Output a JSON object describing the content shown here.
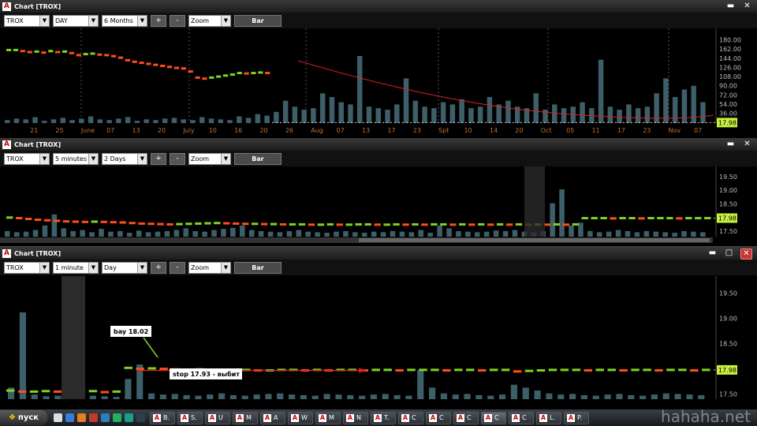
{
  "windows": [
    {
      "title": "Chart [TROX]",
      "symbol": "TROX",
      "interval": "DAY",
      "period": "6 Months",
      "zoom": "Zoom",
      "chart_type_button": "Bar",
      "plus": "+",
      "minus": "-",
      "price_ticks": [
        "180.00",
        "162.00",
        "144.00",
        "126.00",
        "108.00",
        "90.00",
        "72.00",
        "54.00",
        "36.00"
      ],
      "current_price": "17.98",
      "date_ticks": [
        "21",
        "25",
        "June",
        "07",
        "13",
        "20",
        "July",
        "10",
        "16",
        "20",
        "26",
        "Aug",
        "07",
        "13",
        "17",
        "23",
        "Spt",
        "10",
        "14",
        "20",
        "Oct",
        "05",
        "11",
        "17",
        "23",
        "Nov",
        "07"
      ]
    },
    {
      "title": "Chart [TROX]",
      "symbol": "TROX",
      "interval": "5 minutes",
      "period": "2 Days",
      "zoom": "Zoom",
      "chart_type_button": "Bar",
      "plus": "+",
      "minus": "-",
      "price_ticks": [
        "19.50",
        "19.00",
        "18.50",
        "17.50"
      ],
      "current_price": "17.98"
    },
    {
      "title": "Chart [TROX]",
      "symbol": "TROX",
      "interval": "1 minute",
      "period": "Day",
      "zoom": "Zoom",
      "chart_type_button": "Bar",
      "plus": "+",
      "minus": "-",
      "price_ticks": [
        "19.50",
        "19.00",
        "18.50",
        "17.50"
      ],
      "current_price": "17.98",
      "annotations": {
        "buy": "bay 18.02",
        "stop": "stop 17.93 - выбит"
      }
    }
  ],
  "taskbar": {
    "start_label": "пуск",
    "tasks": [
      "B.",
      "S.",
      "U",
      "M",
      "A",
      "W",
      "M",
      "N",
      "T.",
      "C",
      "C",
      "C",
      "C",
      "C",
      "L.",
      "P."
    ]
  },
  "watermark": "hahaha.net",
  "colors": {
    "up": "#7ed321",
    "down": "#ff4d1a",
    "volume": "#3d5f6a",
    "price_box": "#c8f040",
    "trend": "#e02020"
  },
  "chart_data": [
    {
      "type": "bar",
      "title": "Chart [TROX]",
      "ylim": [
        17,
        190
      ],
      "ohlc_close": [
        160,
        160,
        158,
        156,
        157,
        155,
        158,
        156,
        157,
        154,
        150,
        152,
        153,
        151,
        150,
        148,
        145,
        140,
        137,
        135,
        133,
        131,
        129,
        127,
        125,
        124,
        118,
        106,
        104,
        106,
        108,
        110,
        112,
        115,
        114,
        115,
        116,
        115
      ],
      "volume": [
        4,
        6,
        5,
        8,
        3,
        5,
        7,
        4,
        6,
        9,
        5,
        4,
        6,
        8,
        3,
        5,
        4,
        6,
        7,
        5,
        4,
        8,
        6,
        5,
        4,
        9,
        7,
        12,
        10,
        15,
        30,
        22,
        18,
        20,
        40,
        35,
        28,
        25,
        90,
        22,
        20,
        18,
        25,
        60,
        30,
        22,
        20,
        28,
        25,
        32,
        20,
        22,
        35,
        25,
        30,
        22,
        20,
        40,
        18,
        25,
        20,
        22,
        28,
        20,
        85,
        22,
        18,
        25,
        20,
        22,
        40,
        60,
        35,
        45,
        50,
        28
      ]
    },
    {
      "type": "bar",
      "title": "Chart [TROX]",
      "ylim": [
        17.3,
        19.7
      ],
      "close": [
        18.0,
        17.98,
        17.95,
        17.92,
        17.9,
        17.88,
        17.86,
        17.85,
        17.84,
        17.85,
        17.84,
        17.83,
        17.82,
        17.8,
        17.78,
        17.77,
        17.76,
        17.75,
        17.76,
        17.77,
        17.78,
        17.79,
        17.8,
        17.79,
        17.78,
        17.77,
        17.77,
        17.76,
        17.76,
        17.75,
        17.75,
        17.75,
        17.74,
        17.74,
        17.75,
        17.74,
        17.74,
        17.75,
        17.75,
        17.74,
        17.74,
        17.75,
        17.74,
        17.75,
        17.74,
        17.75,
        17.75,
        17.74,
        17.75,
        17.74,
        17.75,
        17.74,
        17.75,
        17.74,
        17.75,
        17.74,
        17.75,
        17.74,
        17.75,
        17.74,
        17.75,
        17.98,
        17.98,
        17.98,
        17.97,
        17.98,
        17.98,
        17.97,
        17.98,
        17.98,
        17.98,
        17.97,
        17.98,
        17.98,
        17.98
      ],
      "volume": [
        10,
        8,
        9,
        12,
        20,
        40,
        15,
        10,
        12,
        8,
        14,
        9,
        10,
        7,
        11,
        8,
        9,
        10,
        12,
        15,
        10,
        9,
        12,
        14,
        16,
        20,
        12,
        10,
        9,
        8,
        10,
        12,
        9,
        8,
        7,
        9,
        10,
        8,
        7,
        9,
        8,
        10,
        9,
        8,
        12,
        7,
        20,
        15,
        10,
        9,
        8,
        9,
        11,
        10,
        12,
        9,
        8,
        10,
        60,
        85,
        20,
        25,
        10,
        8,
        9,
        12,
        10,
        8,
        10,
        9,
        8,
        7,
        10,
        9,
        8
      ]
    },
    {
      "type": "bar",
      "title": "Chart [TROX]",
      "ylim": [
        17.4,
        19.65
      ],
      "close": [
        17.57,
        17.55,
        17.55,
        17.56,
        17.55,
        17.54,
        17.55,
        17.56,
        17.54,
        17.55,
        18.02,
        18.0,
        18.01,
        18.0,
        17.99,
        17.98,
        17.99,
        17.98,
        17.98,
        17.97,
        17.98,
        17.97,
        17.97,
        17.98,
        17.98,
        17.97,
        17.98,
        17.97,
        17.98,
        17.98,
        17.97,
        17.98,
        17.98,
        17.97,
        17.98,
        17.98,
        17.98,
        17.97,
        17.98,
        17.98,
        17.97,
        17.98,
        17.98,
        17.95,
        17.96,
        17.97,
        17.98,
        17.98,
        17.98,
        17.97,
        17.98,
        17.98,
        17.97,
        17.98,
        17.98,
        17.97,
        17.98,
        17.98,
        17.97,
        17.98
      ],
      "volume": [
        20,
        150,
        8,
        5,
        6,
        5,
        4,
        6,
        5,
        4,
        35,
        60,
        10,
        8,
        9,
        7,
        6,
        8,
        10,
        7,
        6,
        8,
        9,
        10,
        8,
        7,
        6,
        9,
        8,
        7,
        6,
        8,
        9,
        7,
        6,
        50,
        20,
        10,
        8,
        9,
        7,
        6,
        8,
        25,
        20,
        15,
        10,
        8,
        9,
        7,
        6,
        8,
        9,
        7,
        6,
        8,
        10,
        9,
        8,
        7
      ]
    }
  ]
}
